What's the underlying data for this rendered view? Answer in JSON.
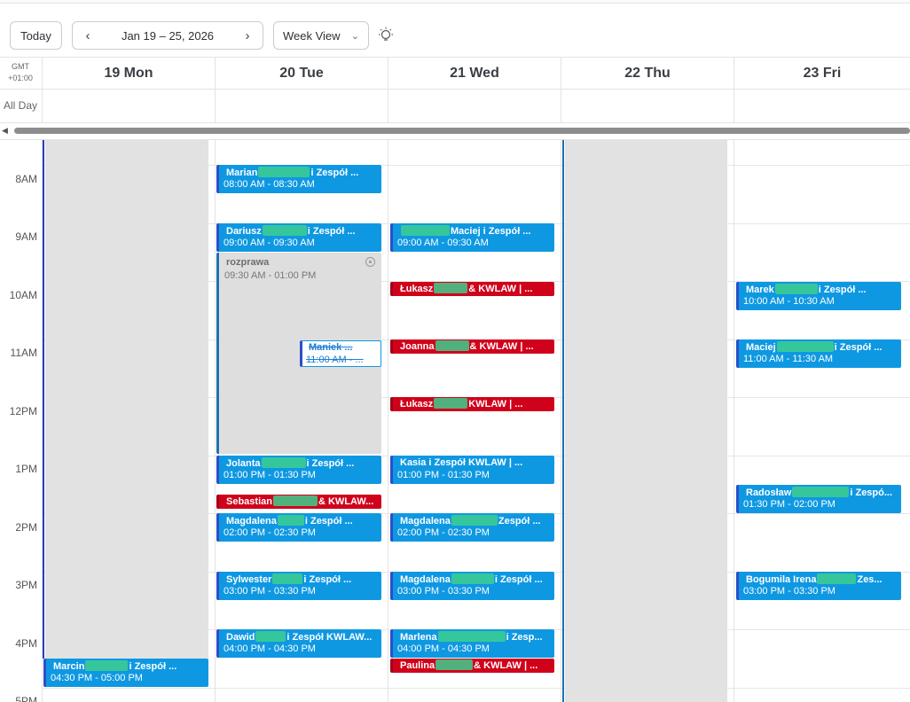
{
  "toolbar": {
    "today_label": "Today",
    "range_label": "Jan 19 – 25, 2026",
    "prev_icon": "‹",
    "next_icon": "›",
    "view_label": "Week View",
    "view_chevron": "⌄",
    "theme_icon": "lightbulb-icon"
  },
  "header": {
    "gmt_line1": "GMT",
    "gmt_line2": "+01:00",
    "days": [
      "19 Mon",
      "20 Tue",
      "21 Wed",
      "22 Thu",
      "23 Fri"
    ],
    "allday_label": "All Day"
  },
  "hours": [
    "8AM",
    "9AM",
    "10AM",
    "11AM",
    "12PM",
    "1PM",
    "2PM",
    "3PM",
    "4PM",
    "5PM"
  ],
  "colors": {
    "event_blue": "#0f98e2",
    "event_red": "#d0021b",
    "unavailable_gray": "#e2e2e2"
  },
  "events": {
    "mon_marcin": {
      "title_a": "Marcin",
      "title_b": "i  Zespół ...",
      "time": "04:30 PM - 05:00 PM"
    },
    "tue_marian": {
      "title_a": "Marian",
      "title_b": "i  Zespół ...",
      "time": "08:00 AM - 08:30 AM"
    },
    "tue_dariusz": {
      "title_a": "Dariusz",
      "title_b": "i  Zespół ...",
      "time": "09:00 AM - 09:30 AM"
    },
    "tue_rozprawa": {
      "title": "rozprawa",
      "time": "09:30 AM - 01:00 PM"
    },
    "tue_maniek": {
      "title": "Maniek ...",
      "time": "11:00 AM - ..."
    },
    "tue_jolanta": {
      "title_a": "Jolanta",
      "title_b": "i  Zespół ...",
      "time": "01:00 PM - 01:30 PM"
    },
    "tue_sebastian": {
      "title_a": "Sebastian",
      "title_b": "& KWLAW..."
    },
    "tue_magdalena": {
      "title_a": "Magdalena",
      "title_b": "i  Zespół ...",
      "time": "02:00 PM - 02:30 PM"
    },
    "tue_sylwester": {
      "title_a": "Sylwester",
      "title_b": "i  Zespół ...",
      "time": "03:00 PM - 03:30 PM"
    },
    "tue_dawid": {
      "title_a": "Dawid",
      "title_b": "i  Zespół KWLAW...",
      "time": "04:00 PM - 04:30 PM"
    },
    "wed_maciej": {
      "title_b": "Maciej i  Zespół ...",
      "time": "09:00 AM - 09:30 AM"
    },
    "wed_lukasz1": {
      "title_a": "Łukasz",
      "title_b": "& KWLAW | ..."
    },
    "wed_joanna": {
      "title_a": "Joanna",
      "title_b": "& KWLAW | ..."
    },
    "wed_lukasz2": {
      "title_a": "Łukasz",
      "title_b": "KWLAW | ..."
    },
    "wed_kasia": {
      "title_a": "Kasia  i  Zespół KWLAW | ...",
      "time": "01:00 PM - 01:30 PM"
    },
    "wed_magdalena1": {
      "title_a": "Magdalena",
      "title_b": "Zespół ...",
      "time": "02:00 PM - 02:30 PM"
    },
    "wed_magdalena2": {
      "title_a": "Magdalena",
      "title_b": "i  Zespół ...",
      "time": "03:00 PM - 03:30 PM"
    },
    "wed_marlena": {
      "title_a": "Marlena",
      "title_b": "i  Zesp...",
      "time": "04:00 PM - 04:30 PM"
    },
    "wed_paulina": {
      "title_a": "Paulina",
      "title_b": "& KWLAW | ..."
    },
    "fri_marek": {
      "title_a": "Marek",
      "title_b": "i  Zespół ...",
      "time": "10:00 AM - 10:30 AM"
    },
    "fri_maciej": {
      "title_a": "Maciej",
      "title_b": "i  Zespół ...",
      "time": "11:00 AM - 11:30 AM"
    },
    "fri_radoslaw": {
      "title_a": "Radosław",
      "title_b": "i  Zespó...",
      "time": "01:30 PM - 02:00 PM"
    },
    "fri_bogumila": {
      "title_a": "Bogumila Irena",
      "title_b": "Zes...",
      "time": "03:00 PM - 03:30 PM"
    }
  }
}
